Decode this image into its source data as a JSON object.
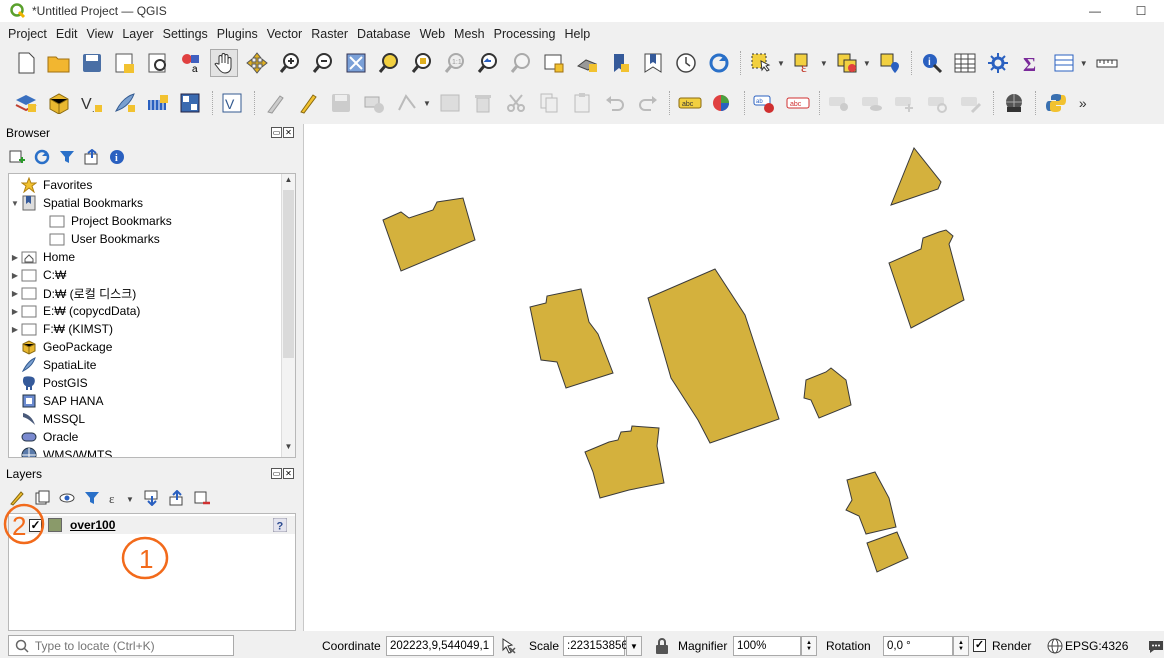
{
  "window": {
    "title": "*Untitled Project — QGIS",
    "minimize": "—",
    "maximize": "☐"
  },
  "menu": [
    "Project",
    "Edit",
    "View",
    "Layer",
    "Settings",
    "Plugins",
    "Vector",
    "Raster",
    "Database",
    "Web",
    "Mesh",
    "Processing",
    "Help"
  ],
  "browser": {
    "title": "Browser",
    "items": [
      {
        "label": "Favorites",
        "icon": "star-icon",
        "arrow": ""
      },
      {
        "label": "Spatial Bookmarks",
        "icon": "bookmark-icon",
        "arrow": "▼"
      },
      {
        "label": "Project Bookmarks",
        "icon": "folder-icon",
        "arrow": ""
      },
      {
        "label": "User Bookmarks",
        "icon": "folder-icon",
        "arrow": ""
      },
      {
        "label": "Home",
        "icon": "home-folder-icon",
        "arrow": "▶"
      },
      {
        "label": "C:₩",
        "icon": "folder-icon",
        "arrow": "▶"
      },
      {
        "label": "D:₩ (로컬 디스크)",
        "icon": "folder-icon",
        "arrow": "▶"
      },
      {
        "label": "E:₩ (copycdData)",
        "icon": "folder-icon",
        "arrow": "▶"
      },
      {
        "label": "F:₩ (KIMST)",
        "icon": "folder-icon",
        "arrow": "▶"
      },
      {
        "label": "GeoPackage",
        "icon": "geopackage-icon",
        "arrow": ""
      },
      {
        "label": "SpatiaLite",
        "icon": "spatialite-icon",
        "arrow": ""
      },
      {
        "label": "PostGIS",
        "icon": "postgis-icon",
        "arrow": ""
      },
      {
        "label": "SAP HANA",
        "icon": "saphana-icon",
        "arrow": ""
      },
      {
        "label": "MSSQL",
        "icon": "mssql-icon",
        "arrow": ""
      },
      {
        "label": "Oracle",
        "icon": "oracle-icon",
        "arrow": ""
      },
      {
        "label": "WMS/WMTS",
        "icon": "wms-icon",
        "arrow": ""
      }
    ]
  },
  "layers": {
    "title": "Layers",
    "items": [
      {
        "name": "over100",
        "checked": "✓",
        "color": "#8a9a6a"
      }
    ]
  },
  "annotations": {
    "one": "1",
    "two": "2",
    "color": "#f26a1b"
  },
  "canvas": {
    "fill": "#d4b13d",
    "stroke": "#3a3a3a"
  },
  "status": {
    "locate_placeholder": "Type to locate (Ctrl+K)",
    "coordinate_label": "Coordinate",
    "coordinate_value": "202223,9,544049,1",
    "scale_label": "Scale",
    "scale_value": ":223153856",
    "magnifier_label": "Magnifier",
    "magnifier_value": "100%",
    "rotation_label": "Rotation",
    "rotation_value": "0,0 °",
    "render_label": "Render",
    "render_checked": "✓",
    "crs": "EPSG:4326"
  }
}
